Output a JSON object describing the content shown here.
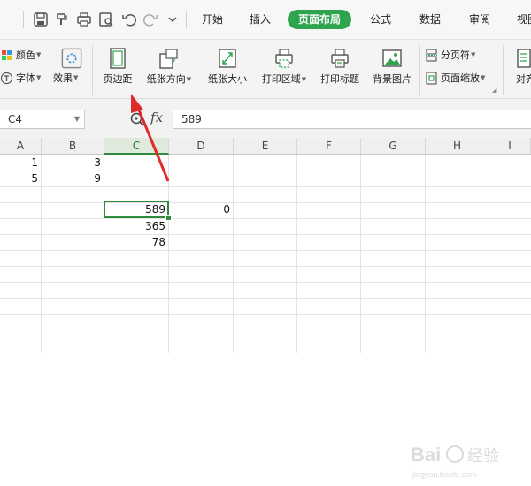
{
  "menubar": {
    "tabs": [
      {
        "label": "开始",
        "active": false
      },
      {
        "label": "插入",
        "active": false
      },
      {
        "label": "页面布局",
        "active": true
      },
      {
        "label": "公式",
        "active": false
      },
      {
        "label": "数据",
        "active": false
      },
      {
        "label": "审阅",
        "active": false
      },
      {
        "label": "视图",
        "active": false
      }
    ],
    "quick_access": [
      "save-icon",
      "format-painter-icon",
      "print-icon",
      "print-preview-icon",
      "undo-icon",
      "redo-icon",
      "customize-icon"
    ],
    "accent_color": "#2ea44f"
  },
  "ribbon": {
    "color_label": "颜色",
    "font_label": "字体",
    "effect_label": "效果",
    "margins_label": "页边距",
    "orientation_label": "纸张方向",
    "size_label": "纸张大小",
    "print_area_label": "打印区域",
    "print_titles_label": "打印标题",
    "background_label": "背景图片",
    "page_break_label": "分页符",
    "page_zoom_label": "页面缩放",
    "align_label": "对齐"
  },
  "formula_bar": {
    "name_box": "C4",
    "fx_label": "fx",
    "formula": "589"
  },
  "grid": {
    "columns": [
      "A",
      "B",
      "C",
      "D",
      "E",
      "F",
      "G",
      "H",
      "I"
    ],
    "selected_column": "C",
    "cells": {
      "A1": "1",
      "B1": "3",
      "A2": "5",
      "B2": "9",
      "C4": "589",
      "D4": "0",
      "C5": "365",
      "C6": "78"
    }
  },
  "watermark": {
    "line1": "Bai",
    "line2": "经验",
    "line3": "jingyan.baidu.com"
  }
}
